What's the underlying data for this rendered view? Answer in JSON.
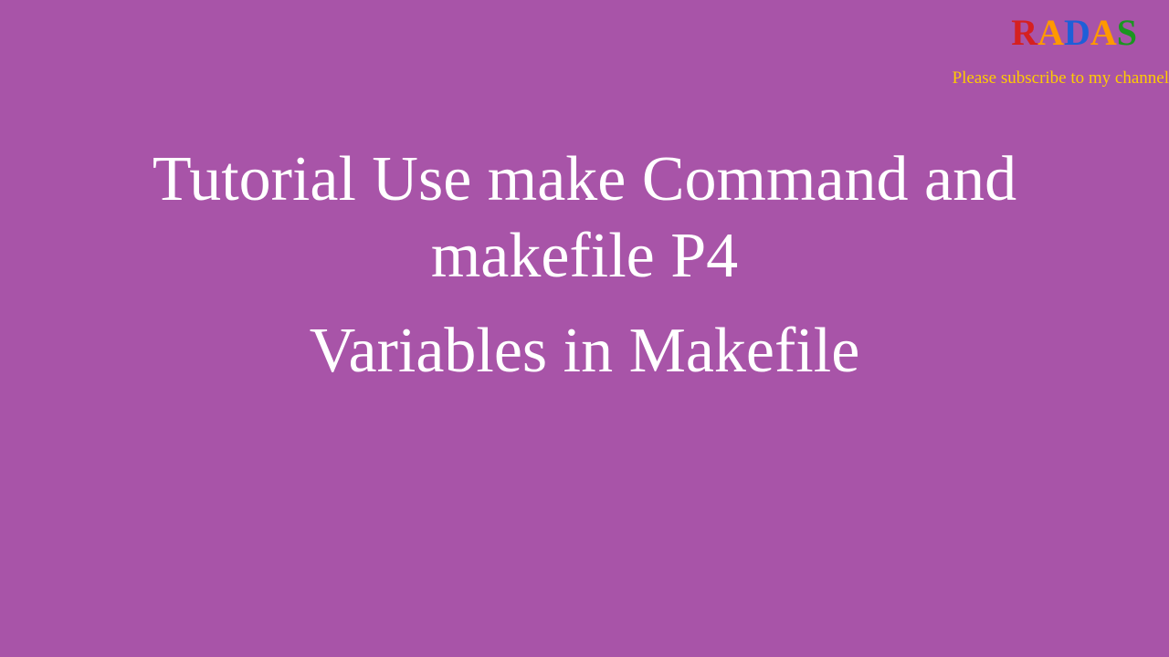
{
  "logo": {
    "r": "R",
    "a1": "A",
    "d": "D",
    "a2": "A",
    "s": "S"
  },
  "subtitle": "Please subscribe to my channel",
  "title": {
    "line1": "Tutorial Use make Command and",
    "line2": "makefile P4",
    "line3": "Variables in Makefile"
  }
}
